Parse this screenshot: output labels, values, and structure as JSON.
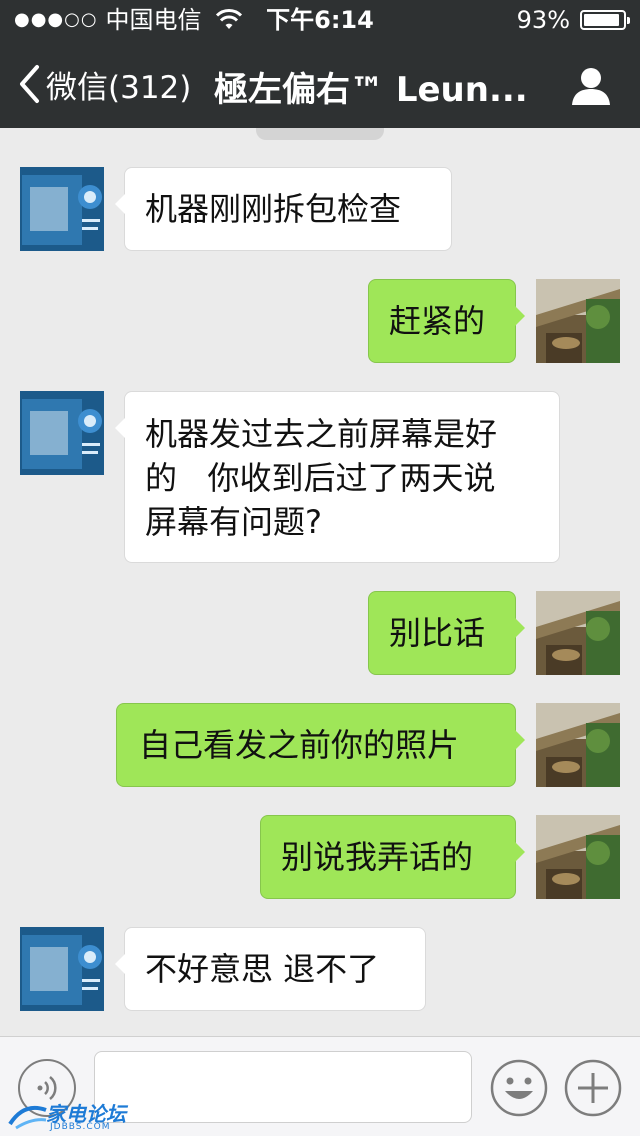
{
  "status_bar": {
    "signal": "●●●○○",
    "carrier": "中国电信",
    "time": "下午6:14",
    "battery_percent": "93%",
    "battery_level": 0.93
  },
  "nav": {
    "back_label": "微信(312)",
    "title": "極左偏右™ Leun..."
  },
  "messages": [
    {
      "direction": "incoming",
      "lines": [
        "机器刚刚拆包检查"
      ]
    },
    {
      "direction": "outgoing",
      "lines": [
        "赶紧的"
      ]
    },
    {
      "direction": "incoming",
      "lines": [
        "机器发过去之前屏幕是好",
        "的   你收到后过了两天说",
        "屏幕有问题?"
      ]
    },
    {
      "direction": "outgoing",
      "lines": [
        "别比话"
      ]
    },
    {
      "direction": "outgoing",
      "lines": [
        "自己看发之前你的照片"
      ]
    },
    {
      "direction": "outgoing",
      "lines": [
        "别说我弄话的"
      ]
    },
    {
      "direction": "incoming",
      "lines": [
        "不好意思 退不了"
      ]
    }
  ],
  "input_bar": {
    "placeholder": ""
  },
  "watermark": {
    "brand": "家电论坛",
    "domain": "JDBBS.COM"
  },
  "colors": {
    "header_bg": "#2e3132",
    "chat_bg": "#ebebeb",
    "outgoing_bubble": "#9fe658",
    "incoming_bubble": "#ffffff"
  },
  "icons": {
    "back": "chevron-left-icon",
    "profile": "person-icon",
    "voice": "voice-wave-icon",
    "emoji": "smiley-icon",
    "plus": "plus-circle-icon",
    "wifi": "wifi-icon",
    "battery": "battery-icon"
  }
}
